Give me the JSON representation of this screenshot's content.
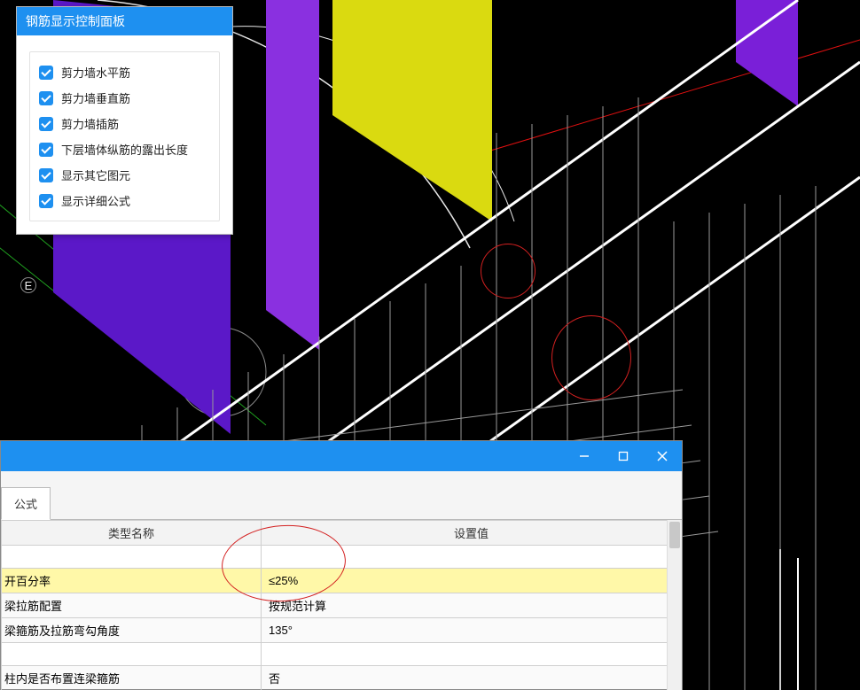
{
  "panel": {
    "title": "钢筋显示控制面板",
    "options": [
      "剪力墙水平筋",
      "剪力墙垂直筋",
      "剪力墙插筋",
      "下层墙体纵筋的露出长度",
      "显示其它图元",
      "显示详细公式"
    ]
  },
  "gridLabelE": "E",
  "dialog": {
    "tabLabel": "公式",
    "headers": {
      "name": "类型名称",
      "value": "设置值"
    },
    "rows": [
      {
        "name": "开百分率",
        "value": "≤25%",
        "hl": true
      },
      {
        "name": "梁拉筋配置",
        "value": "按规范计算"
      },
      {
        "name": "梁箍筋及拉筋弯勾角度",
        "value": "135°"
      }
    ],
    "spacerAfter": 2,
    "lastRow": {
      "name": "柱内是否布置连梁箍筋",
      "value": "否"
    }
  }
}
